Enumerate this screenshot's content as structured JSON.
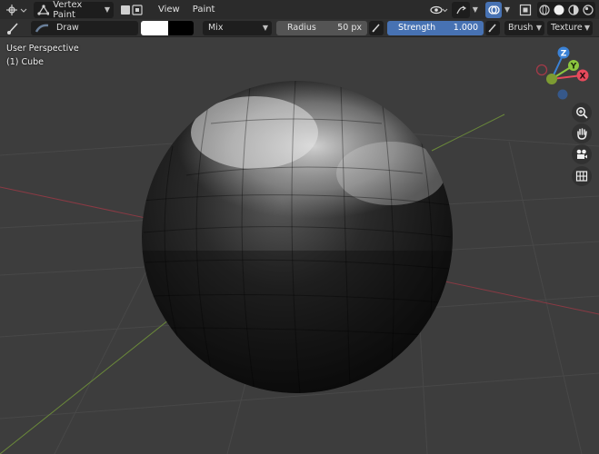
{
  "header": {
    "mode_label": "Vertex Paint",
    "menus": [
      "View",
      "Paint"
    ]
  },
  "toolbar": {
    "brush_name": "Draw",
    "blend_mode": "Mix",
    "radius_label": "Radius",
    "radius_value": "50 px",
    "strength_label": "Strength",
    "strength_value": "1.000",
    "brush_menu": "Brush",
    "texture_menu": "Texture"
  },
  "viewport": {
    "perspective_label": "User Perspective",
    "object_label": "(1) Cube"
  },
  "gizmo": {
    "z_label": "Z",
    "y_label": "Y",
    "x_label": "X"
  },
  "colors": {
    "accent": "#4772b3",
    "axis_x": "#e74a5c",
    "axis_y": "#8cc63f",
    "axis_z": "#3b82d6",
    "primary_color": "#ffffff",
    "secondary_color": "#000000"
  },
  "nav_icons": [
    "zoom-icon",
    "pan-hand-icon",
    "camera-icon",
    "grid-icon"
  ]
}
